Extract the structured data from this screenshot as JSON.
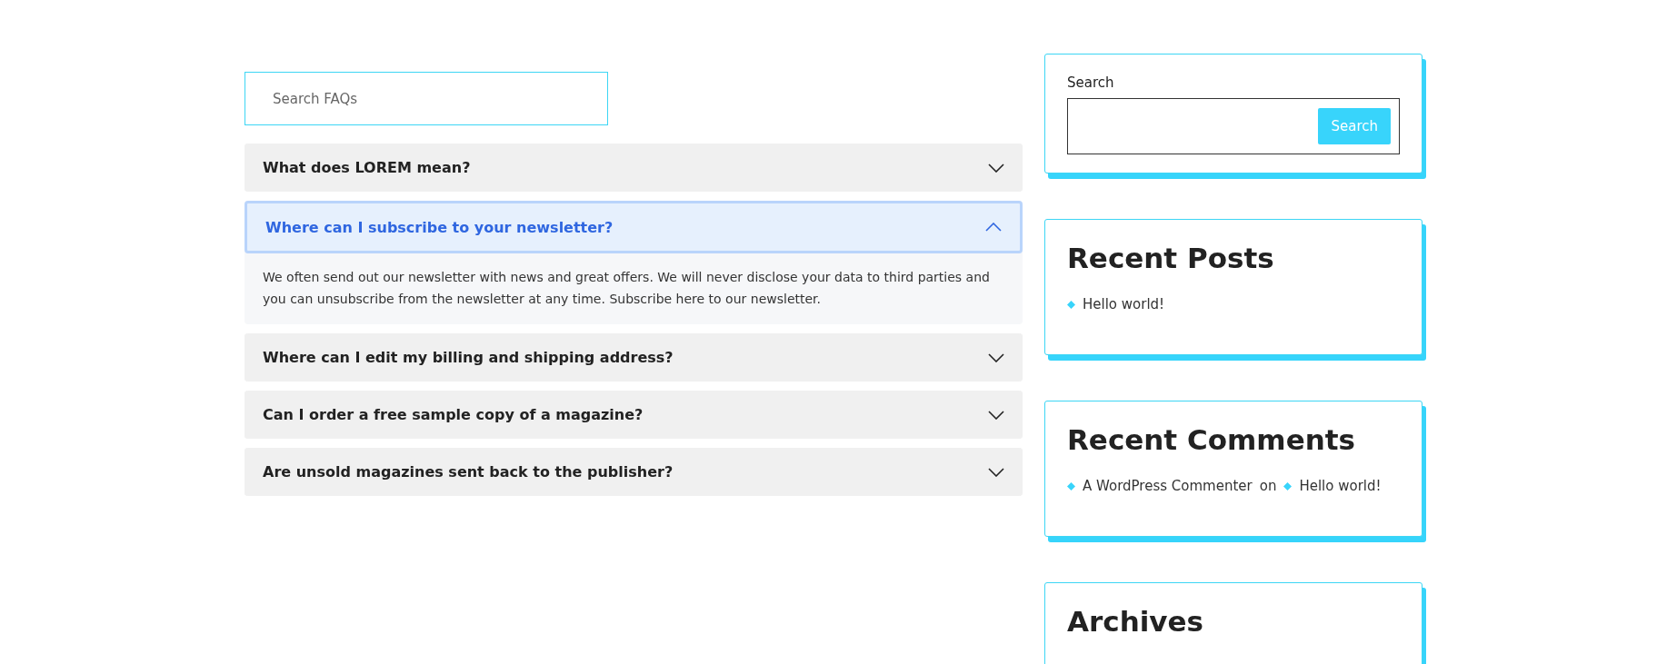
{
  "faq": {
    "search": {
      "placeholder": "Search FAQs"
    },
    "items": [
      {
        "question": "What does LOREM mean?",
        "expanded": false
      },
      {
        "question": "Where can I subscribe to your newsletter?",
        "expanded": true,
        "answer": "We often send out our newsletter with news and great offers. We will never disclose your data to third parties and you can unsubscribe from the newsletter at any time. Subscribe here to our newsletter."
      },
      {
        "question": "Where can I edit my billing and shipping address?",
        "expanded": false
      },
      {
        "question": "Can I order a free sample copy of a magazine?",
        "expanded": false
      },
      {
        "question": "Are unsold magazines sent back to the publisher?",
        "expanded": false
      }
    ]
  },
  "sidebar": {
    "search": {
      "label": "Search",
      "button": "Search"
    },
    "widgets": [
      {
        "kind": "posts",
        "title": "Recent Posts",
        "items": [
          {
            "title": "Hello world!"
          }
        ]
      },
      {
        "kind": "comments",
        "title": "Recent Comments",
        "items": [
          {
            "author": "A WordPress Commenter",
            "connector": "on",
            "post": "Hello world!"
          }
        ]
      },
      {
        "kind": "archives",
        "title": "Archives"
      }
    ]
  }
}
